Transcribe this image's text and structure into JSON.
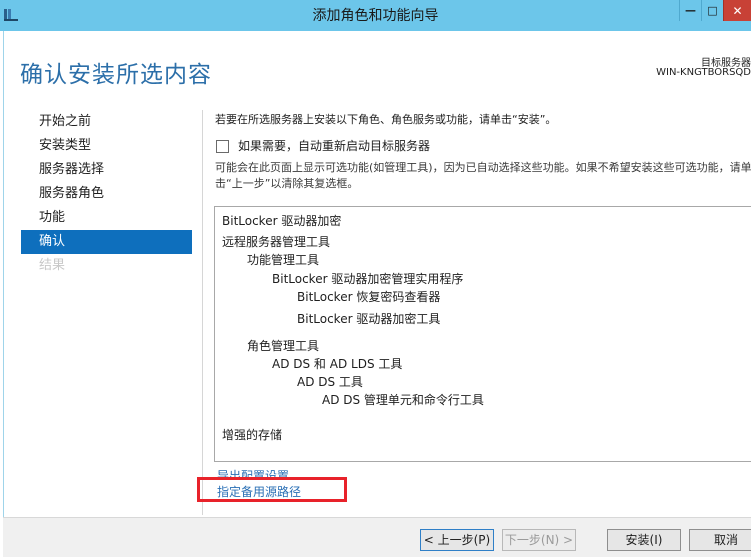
{
  "window": {
    "title": "添加角色和功能向导",
    "minimize_glyph": "—",
    "maximize_glyph": "□",
    "close_glyph": "✕"
  },
  "header": {
    "page_title": "确认安装所选内容",
    "target_label": "目标服务器",
    "target_server": "WIN-KNGTBORSQD"
  },
  "nav": {
    "items": [
      {
        "label": "开始之前",
        "state": "normal"
      },
      {
        "label": "安装类型",
        "state": "normal"
      },
      {
        "label": "服务器选择",
        "state": "normal"
      },
      {
        "label": "服务器角色",
        "state": "normal"
      },
      {
        "label": "功能",
        "state": "normal"
      },
      {
        "label": "确认",
        "state": "active"
      },
      {
        "label": "结果",
        "state": "disabled"
      }
    ]
  },
  "content": {
    "instruction": "若要在所选服务器上安装以下角色、角色服务或功能，请单击“安装”。",
    "restart_checkbox_label": "如果需要，自动重新启动目标服务器",
    "restart_checked": false,
    "note": "可能会在此页面上显示可选功能(如管理工具)，因为已自动选择这些功能。如果不希望安装这些可选功能，请单击“上一步”以清除其复选框。",
    "features": [
      {
        "label": "BitLocker 驱动器加密",
        "level": 0
      },
      {
        "label": "远程服务器管理工具",
        "level": 0
      },
      {
        "label": "功能管理工具",
        "level": 1
      },
      {
        "label": "BitLocker 驱动器加密管理实用程序",
        "level": 2
      },
      {
        "label": "BitLocker 恢复密码查看器",
        "level": 3
      },
      {
        "label": "BitLocker 驱动器加密工具",
        "level": 3
      },
      {
        "label": "角色管理工具",
        "level": 1
      },
      {
        "label": "AD DS 和 AD LDS 工具",
        "level": 2
      },
      {
        "label": "AD DS 工具",
        "level": 3
      },
      {
        "label": "AD DS 管理单元和命令行工具",
        "level": 4
      },
      {
        "label": "增强的存储",
        "level": 0
      }
    ],
    "export_link": "导出配置设置",
    "alt_source_link": "指定备用源路径"
  },
  "footer": {
    "prev_label": "< 上一步(P)",
    "next_label": "下一步(N) >",
    "install_label": "安装(I)",
    "cancel_label": "取消"
  },
  "colors": {
    "titlebar": "#6cc6ea",
    "accent": "#0e6fbd",
    "title_text": "#2c6fa9",
    "link": "#2a6fb5",
    "highlight_box": "#e8222a"
  }
}
